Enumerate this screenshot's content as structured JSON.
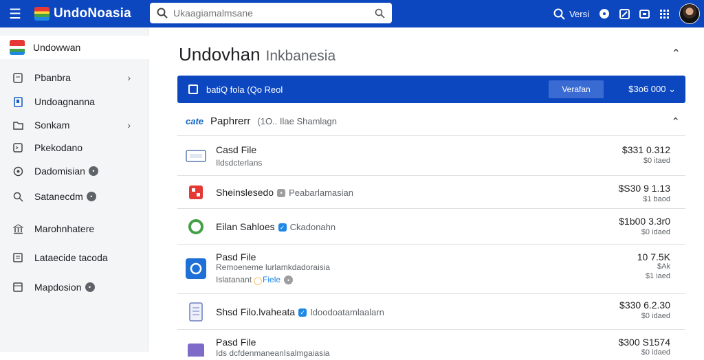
{
  "app": {
    "title": "UndoNoasia"
  },
  "search": {
    "placeholder": "Ukaagiamalmsane"
  },
  "topbar": {
    "label": "Versi"
  },
  "sidebar": {
    "items": [
      {
        "label": "Undowwan",
        "icon": "flag-icon"
      },
      {
        "label": "Pbanbra",
        "icon": "document-icon"
      },
      {
        "label": "Undoagnanna",
        "icon": "bookmark-icon"
      },
      {
        "label": "Sonkam",
        "icon": "folder-icon"
      },
      {
        "label": "Pkekodano",
        "icon": "image-icon"
      },
      {
        "label": "Dadomisian",
        "icon": "location-icon"
      },
      {
        "label": "Satanecdm",
        "icon": "search-icon"
      },
      {
        "label": "Marohnhatere",
        "icon": "bank-icon"
      },
      {
        "label": "Lataecide tacoda",
        "icon": "receipt-icon"
      },
      {
        "label": "Mapdosion",
        "icon": "calendar-icon"
      }
    ]
  },
  "page": {
    "title": "Undovhan",
    "subtitle": "Inkbanesia"
  },
  "banner": {
    "text": "batiQ fola (Qo Reol",
    "button": "Verafan",
    "amount": "$3o6 000"
  },
  "section": {
    "logo": "cate",
    "title": "Paphrerr",
    "meta": "(1O.. Ilae Shamlagn"
  },
  "rows": [
    {
      "title": "Casd File",
      "sub": "Ildsdcterlans",
      "amount": "$331 0.312",
      "amount_sub": "$0 itaed"
    },
    {
      "title": "Sheinslesedo",
      "badge_text": "Peabarlamasian",
      "amount": "$S30 9 1.13",
      "amount_sub": "$1 baod"
    },
    {
      "title": "Eilan Sahloes",
      "badge_text": "Ckadonahn",
      "amount": "$1b00 3.3r0",
      "amount_sub": "$0 idaed"
    },
    {
      "title": "Pasd File",
      "sub": "Remoeneme lurlamkdadoraisia",
      "sub2": "Islatanant",
      "sub2_badge": "Fiele",
      "amount": "10 7.5K",
      "amount_sub": "$Ak",
      "amount_sub2": "$1 iaed"
    },
    {
      "title": "Shsd Filo.lvaheata",
      "badge_text": "Idoodoatamlaalarn",
      "amount": "$330 6.2.30",
      "amount_sub": "$0 idaed"
    },
    {
      "title": "Pasd File",
      "sub": "Ids dcfdenmaneanIsalmgaiasia",
      "amount": "$300 S1574",
      "amount_sub": "$0 idaed"
    }
  ],
  "colors": {
    "brand": "#0d47c0",
    "sidebar_bg": "#f4f5f7",
    "accent": "#1e88e5"
  }
}
